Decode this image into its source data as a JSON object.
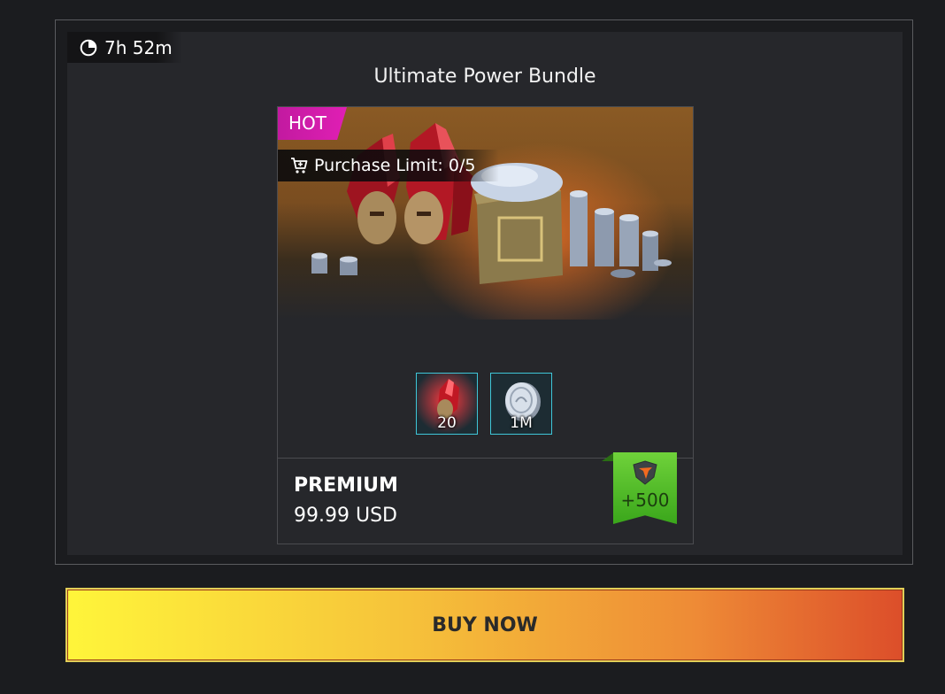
{
  "timer": {
    "text": "7h 52m",
    "icon": "clock-icon"
  },
  "bundle": {
    "title": "Ultimate Power Bundle",
    "badge": "HOT",
    "purchase_limit": "Purchase Limit: 0/5",
    "rewards": [
      {
        "name": "crystal",
        "icon": "crystal-icon",
        "quantity": "20"
      },
      {
        "name": "silver",
        "icon": "silver-coin-icon",
        "quantity": "1M"
      }
    ],
    "tier": "PREMIUM",
    "price": "99.99 USD",
    "bonus": {
      "amount": "+500",
      "icon": "shield-emblem-icon",
      "color": "#5cc22c"
    }
  },
  "buy_button": {
    "label": "BUY NOW"
  },
  "colors": {
    "hot_badge": "#d81eaa",
    "reward_border": "#3fc6d8",
    "button_start": "#fff53a",
    "button_end": "#dc4e2a"
  }
}
